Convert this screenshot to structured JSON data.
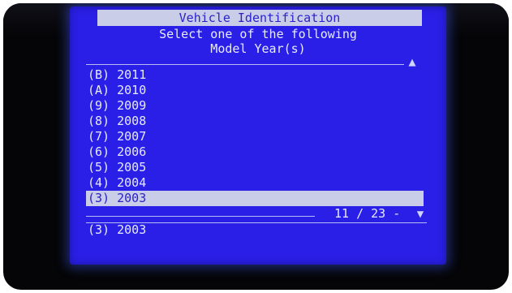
{
  "header": {
    "title": "Vehicle Identification",
    "instruction_line1": "Select one of the following",
    "instruction_line2": "Model Year(s)"
  },
  "list": {
    "items": [
      {
        "code": "(B)",
        "label": "2011"
      },
      {
        "code": "(A)",
        "label": "2010"
      },
      {
        "code": "(9)",
        "label": "2009"
      },
      {
        "code": "(8)",
        "label": "2008"
      },
      {
        "code": "(7)",
        "label": "2007"
      },
      {
        "code": "(6)",
        "label": "2006"
      },
      {
        "code": "(5)",
        "label": "2005"
      },
      {
        "code": "(4)",
        "label": "2004"
      },
      {
        "code": "(3)",
        "label": "2003"
      }
    ],
    "selected_index": 8
  },
  "pager": {
    "counter": "11 / 23 -",
    "up_icon": "triangle-up-icon",
    "down_icon": "triangle-down-icon"
  },
  "footer": {
    "selection": "(3) 2003"
  },
  "colors": {
    "screen_blue": "#2a1fe6",
    "highlight": "#c9cde8",
    "highlight_text": "#2a22c8",
    "text": "#e6e9ff"
  }
}
